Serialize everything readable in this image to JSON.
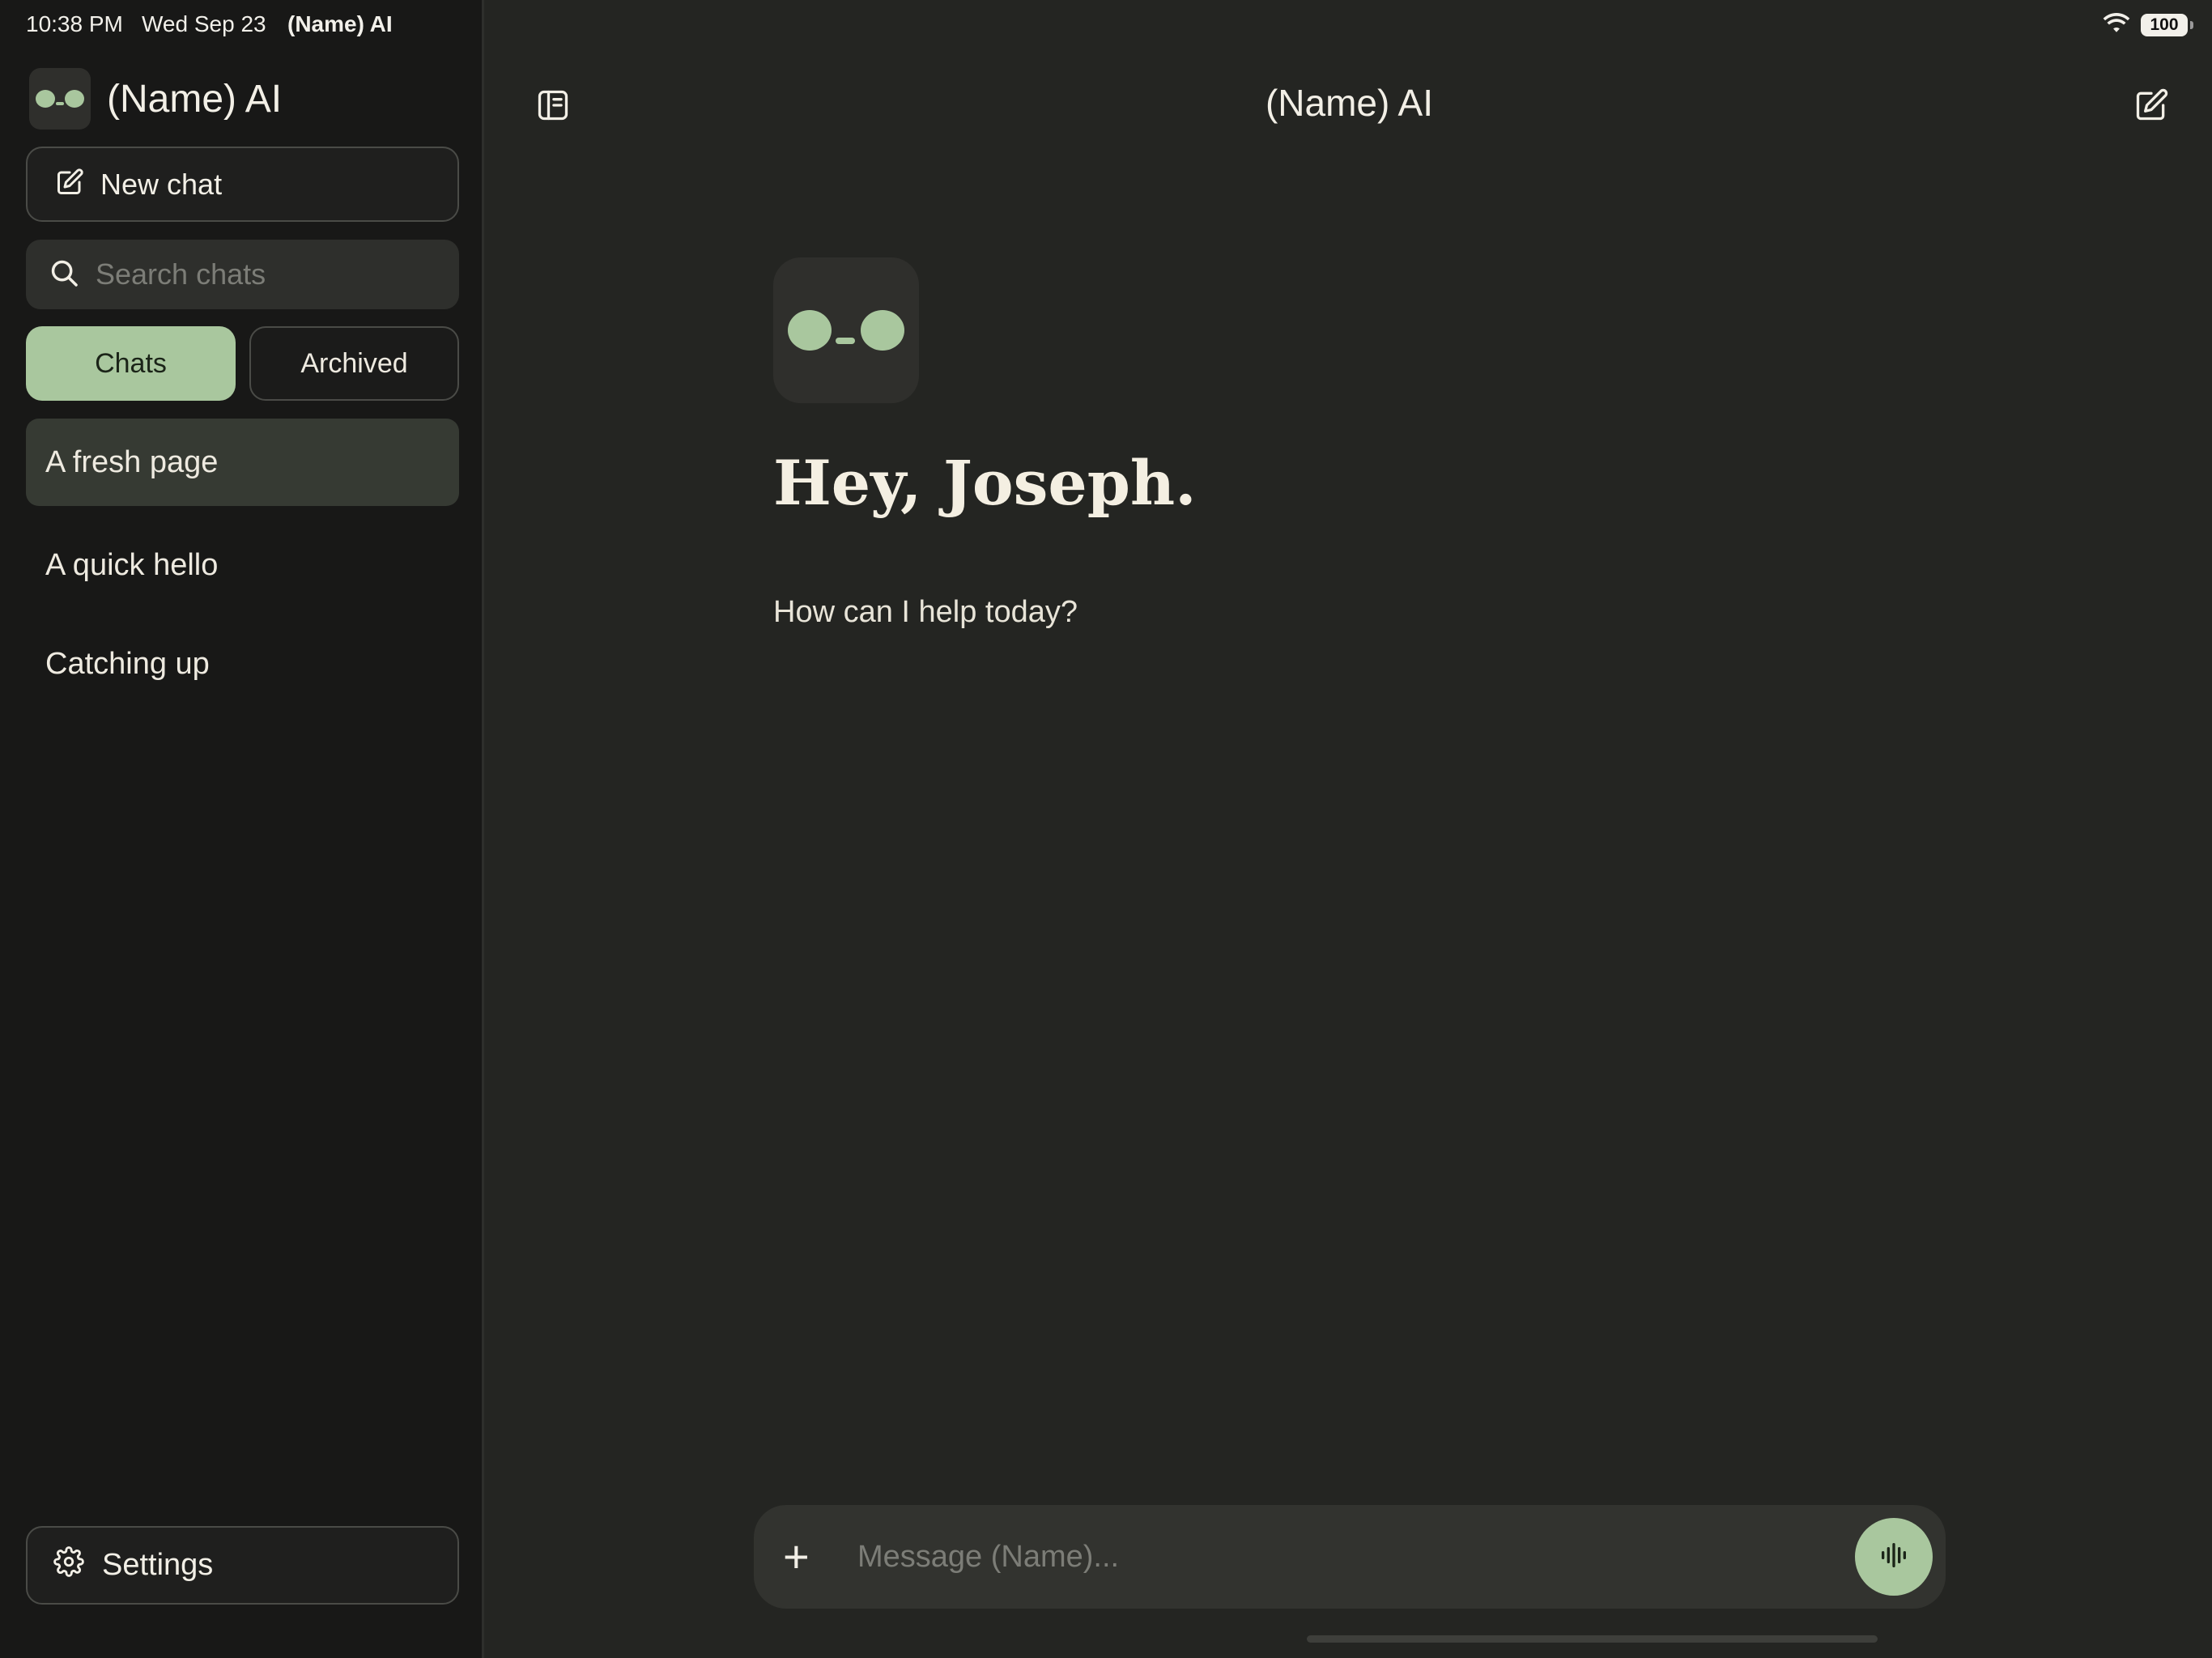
{
  "status_bar": {
    "time": "10:38 PM",
    "date": "Wed Sep 23",
    "app": "(Name) AI",
    "battery": "100"
  },
  "sidebar": {
    "app_name": "(Name) AI",
    "new_chat_label": "New chat",
    "search_placeholder": "Search chats",
    "tabs": [
      {
        "label": "Chats",
        "selected": true
      },
      {
        "label": "Archived",
        "selected": false
      }
    ],
    "chats": [
      {
        "title": "A fresh page",
        "active": true
      },
      {
        "title": "A quick hello",
        "active": false
      },
      {
        "title": "Catching up",
        "active": false
      }
    ],
    "settings_label": "Settings"
  },
  "main": {
    "title": "(Name) AI",
    "greeting": "Hey, Joseph.",
    "subtitle": "How can I help today?",
    "composer_placeholder": "Message (Name)..."
  },
  "colors": {
    "accent": "#a9c79e",
    "sidebar_bg": "#181817",
    "main_bg": "#242522",
    "selected_chat_bg": "#363a33",
    "text": "#f2efe6"
  },
  "icons": {
    "sidebar_toggle": "sidebar-icon",
    "compose": "compose-icon",
    "search": "search-icon",
    "settings": "gear-icon",
    "attach": "plus-icon",
    "voice": "waveform-icon",
    "wifi": "wifi-icon",
    "battery": "battery-icon"
  }
}
